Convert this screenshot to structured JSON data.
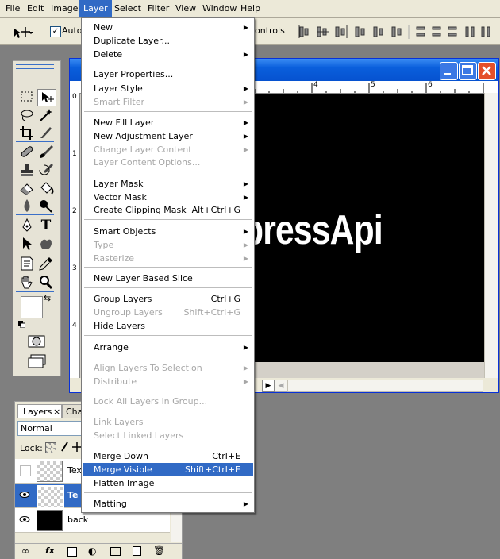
{
  "menubar": {
    "items": [
      "File",
      "Edit",
      "Image",
      "Layer",
      "Select",
      "Filter",
      "View",
      "Window",
      "Help"
    ],
    "active": "Layer"
  },
  "optionsbar": {
    "auto_label": "Auto",
    "controls_label": "ontrols"
  },
  "document": {
    "canvas_text": "pressApi",
    "ruler_top": [
      "4",
      "5",
      "6"
    ],
    "ruler_left": [
      "0",
      "1",
      "2",
      "3",
      "4",
      "1"
    ]
  },
  "layers_panel": {
    "tabs": [
      "Layers",
      "Cha"
    ],
    "blend_mode": "Normal",
    "lock_label": "Lock:",
    "rows": [
      {
        "name": "Tex"
      },
      {
        "name": "Te"
      },
      {
        "name": "back"
      }
    ]
  },
  "layer_menu": {
    "items": [
      {
        "label": "New",
        "submenu": true
      },
      {
        "label": "Duplicate Layer..."
      },
      {
        "label": "Delete",
        "submenu": true
      },
      {
        "label": "Layer Properties..."
      },
      {
        "label": "Layer Style",
        "submenu": true
      },
      {
        "label": "Smart Filter",
        "submenu": true,
        "disabled": true
      },
      {
        "label": "New Fill Layer",
        "submenu": true
      },
      {
        "label": "New Adjustment Layer",
        "submenu": true
      },
      {
        "label": "Change Layer Content",
        "submenu": true,
        "disabled": true
      },
      {
        "label": "Layer Content Options...",
        "disabled": true
      },
      {
        "label": "Layer Mask",
        "submenu": true
      },
      {
        "label": "Vector Mask",
        "submenu": true
      },
      {
        "label": "Create Clipping Mask",
        "shortcut": "Alt+Ctrl+G"
      },
      {
        "label": "Smart Objects",
        "submenu": true
      },
      {
        "label": "Type",
        "submenu": true,
        "disabled": true
      },
      {
        "label": "Rasterize",
        "submenu": true,
        "disabled": true
      },
      {
        "label": "New Layer Based Slice"
      },
      {
        "label": "Group Layers",
        "shortcut": "Ctrl+G"
      },
      {
        "label": "Ungroup Layers",
        "shortcut": "Shift+Ctrl+G",
        "disabled": true
      },
      {
        "label": "Hide Layers"
      },
      {
        "label": "Arrange",
        "submenu": true
      },
      {
        "label": "Align Layers To Selection",
        "submenu": true,
        "disabled": true
      },
      {
        "label": "Distribute",
        "submenu": true,
        "disabled": true
      },
      {
        "label": "Lock All Layers in Group...",
        "disabled": true
      },
      {
        "label": "Link Layers",
        "disabled": true
      },
      {
        "label": "Select Linked Layers",
        "disabled": true
      },
      {
        "label": "Merge Down",
        "shortcut": "Ctrl+E"
      },
      {
        "label": "Merge Visible",
        "shortcut": "Shift+Ctrl+E",
        "highlighted": true
      },
      {
        "label": "Flatten Image"
      },
      {
        "label": "Matting",
        "submenu": true
      }
    ]
  }
}
